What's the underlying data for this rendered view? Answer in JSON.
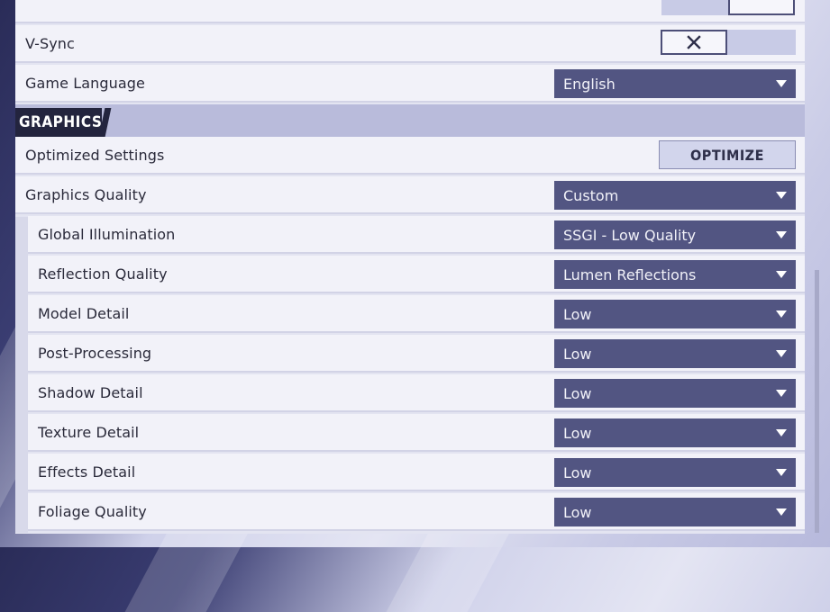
{
  "vsync": {
    "label": "V-Sync",
    "checked": false
  },
  "game_language": {
    "label": "Game Language",
    "value": "English"
  },
  "graphics_section": {
    "title": "GRAPHICS"
  },
  "optimized_settings": {
    "label": "Optimized Settings",
    "button": "OPTIMIZE"
  },
  "graphics_quality": {
    "label": "Graphics Quality",
    "value": "Custom"
  },
  "sub_settings": [
    {
      "label": "Global Illumination",
      "value": "SSGI - Low Quality"
    },
    {
      "label": "Reflection Quality",
      "value": "Lumen Reflections"
    },
    {
      "label": "Model Detail",
      "value": "Low"
    },
    {
      "label": "Post-Processing",
      "value": "Low"
    },
    {
      "label": "Shadow Detail",
      "value": "Low"
    },
    {
      "label": "Texture Detail",
      "value": "Low"
    },
    {
      "label": "Effects Detail",
      "value": "Low"
    },
    {
      "label": "Foliage Quality",
      "value": "Low"
    }
  ],
  "colors": {
    "dropdown_bg": "#525582",
    "row_bg": "#f2f2f9",
    "section_bg": "#b9bbdb",
    "section_tab": "#23243e"
  }
}
